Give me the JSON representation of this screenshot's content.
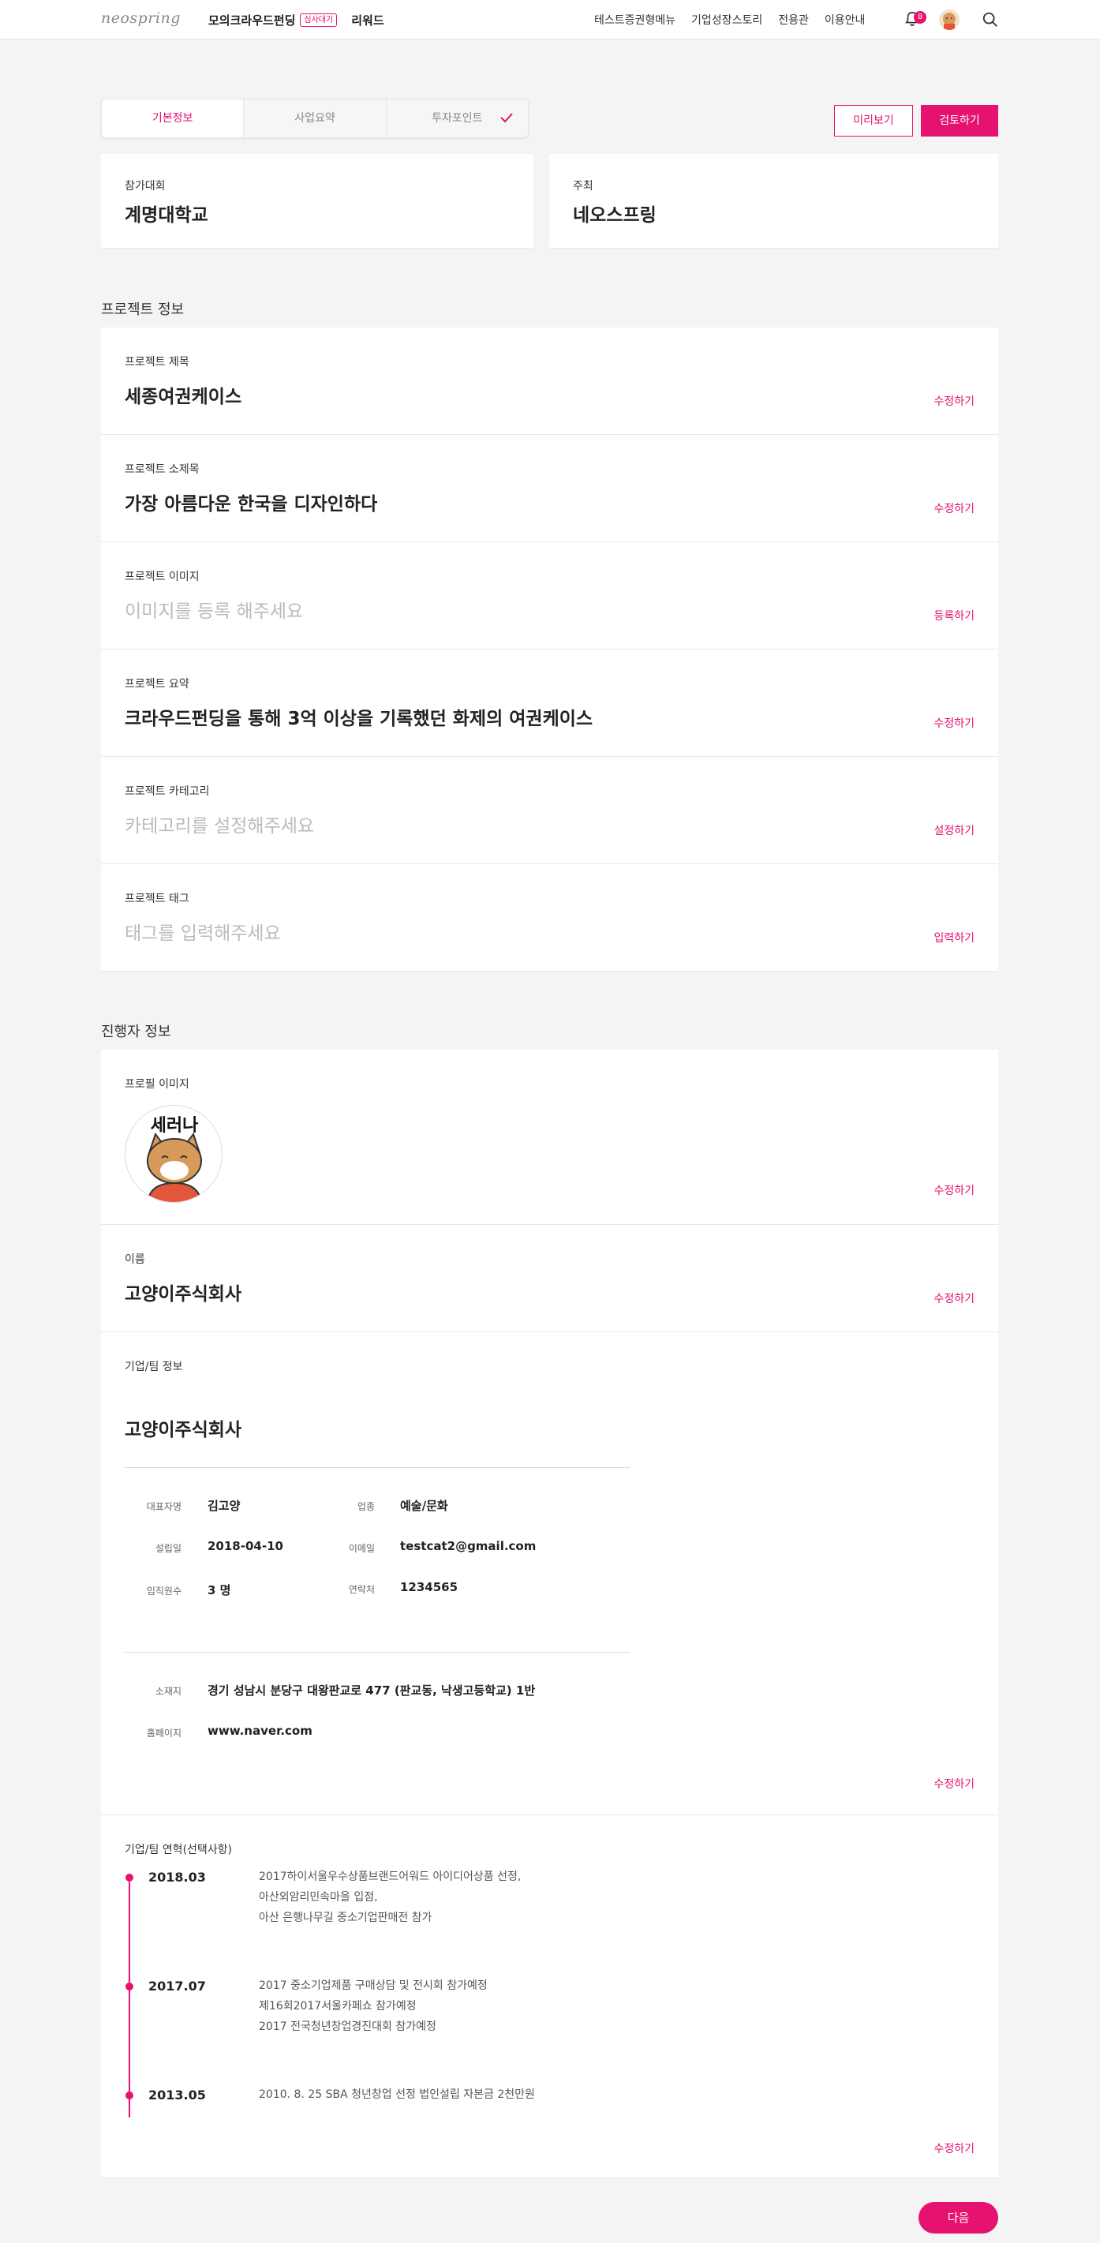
{
  "header": {
    "logo": "neospring",
    "gnb_main": "모의크라우드펀딩",
    "gnb_badge": "심사대기",
    "gnb_reward": "리워드",
    "nav": [
      "테스트증권형메뉴",
      "기업성장스토리",
      "전용관",
      "이용안내"
    ],
    "notif_count": "8"
  },
  "tabs": [
    {
      "label": "기본정보",
      "active": true
    },
    {
      "label": "사업요약",
      "active": false
    },
    {
      "label": "투자포인트",
      "active": false
    }
  ],
  "actions": {
    "preview": "미리보기",
    "review": "검토하기"
  },
  "contest": {
    "label": "참가대회",
    "value": "계명대학교"
  },
  "host": {
    "label": "주최",
    "value": "네오스프링"
  },
  "project_section_title": "프로젝트 정보",
  "project": [
    {
      "label": "프로젝트 제목",
      "value": "세종여권케이스",
      "placeholder": false,
      "action": "수정하기"
    },
    {
      "label": "프로젝트 소제목",
      "value": "가장 아름다운 한국을 디자인하다",
      "placeholder": false,
      "action": "수정하기"
    },
    {
      "label": "프로젝트 이미지",
      "value": "이미지를 등록 해주세요",
      "placeholder": true,
      "action": "등록하기"
    },
    {
      "label": "프로젝트 요약",
      "value": "크라우드펀딩을 통해 3억 이상을 기록했던 화제의 여권케이스",
      "placeholder": false,
      "action": "수정하기"
    },
    {
      "label": "프로젝트 카테고리",
      "value": "카테고리를 설정해주세요",
      "placeholder": true,
      "action": "설정하기"
    },
    {
      "label": "프로젝트 태그",
      "value": "태그를 입력해주세요",
      "placeholder": true,
      "action": "입력하기"
    }
  ],
  "host_section_title": "진행자 정보",
  "profile": {
    "label": "프로필 이미지",
    "image_text": "세러나",
    "action": "수정하기"
  },
  "name": {
    "label": "이름",
    "value": "고양이주식회사",
    "action": "수정하기"
  },
  "company": {
    "label": "기업/팀 정보",
    "name": "고양이주식회사",
    "ceo_label": "대표자명",
    "ceo": "김고양",
    "industry_label": "업종",
    "industry": "예술/문화",
    "founded_label": "설립일",
    "founded": "2018-04-10",
    "email_label": "이메일",
    "email": "testcat2@gmail.com",
    "staff_label": "임직원수",
    "staff": "3 명",
    "phone_label": "연락처",
    "phone": "1234565",
    "address_label": "소재지",
    "address": "경기 성남시 분당구 대왕판교로 477 (판교동, 낙생고등학교) 1반",
    "homepage_label": "홈페이지",
    "homepage": "www.naver.com",
    "action": "수정하기"
  },
  "history": {
    "label": "기업/팀 연혁(선택사항)",
    "items": [
      {
        "year": "2018.03",
        "lines": [
          "2017하이서울우수상품브랜드어워드 아이디어상품 선정,",
          "아산외암리민속마을 입점,",
          "아산 은행나무길 중소기업판매전 참가"
        ]
      },
      {
        "year": "2017.07",
        "lines": [
          "2017 중소기업제품 구매상담 및 전시회 참가예정",
          "제16회2017서울카페쇼 참가예정",
          "2017 전국청년창업경진대회 참가예정"
        ]
      },
      {
        "year": "2013.05",
        "lines": [
          "2010. 8. 25 SBA 청년창업 선정 법인설립 자본금 2천만원"
        ]
      }
    ],
    "action": "수정하기"
  },
  "next": "다음",
  "colors": {
    "accent": "#e5126f",
    "bg": "#f4f4f4"
  }
}
